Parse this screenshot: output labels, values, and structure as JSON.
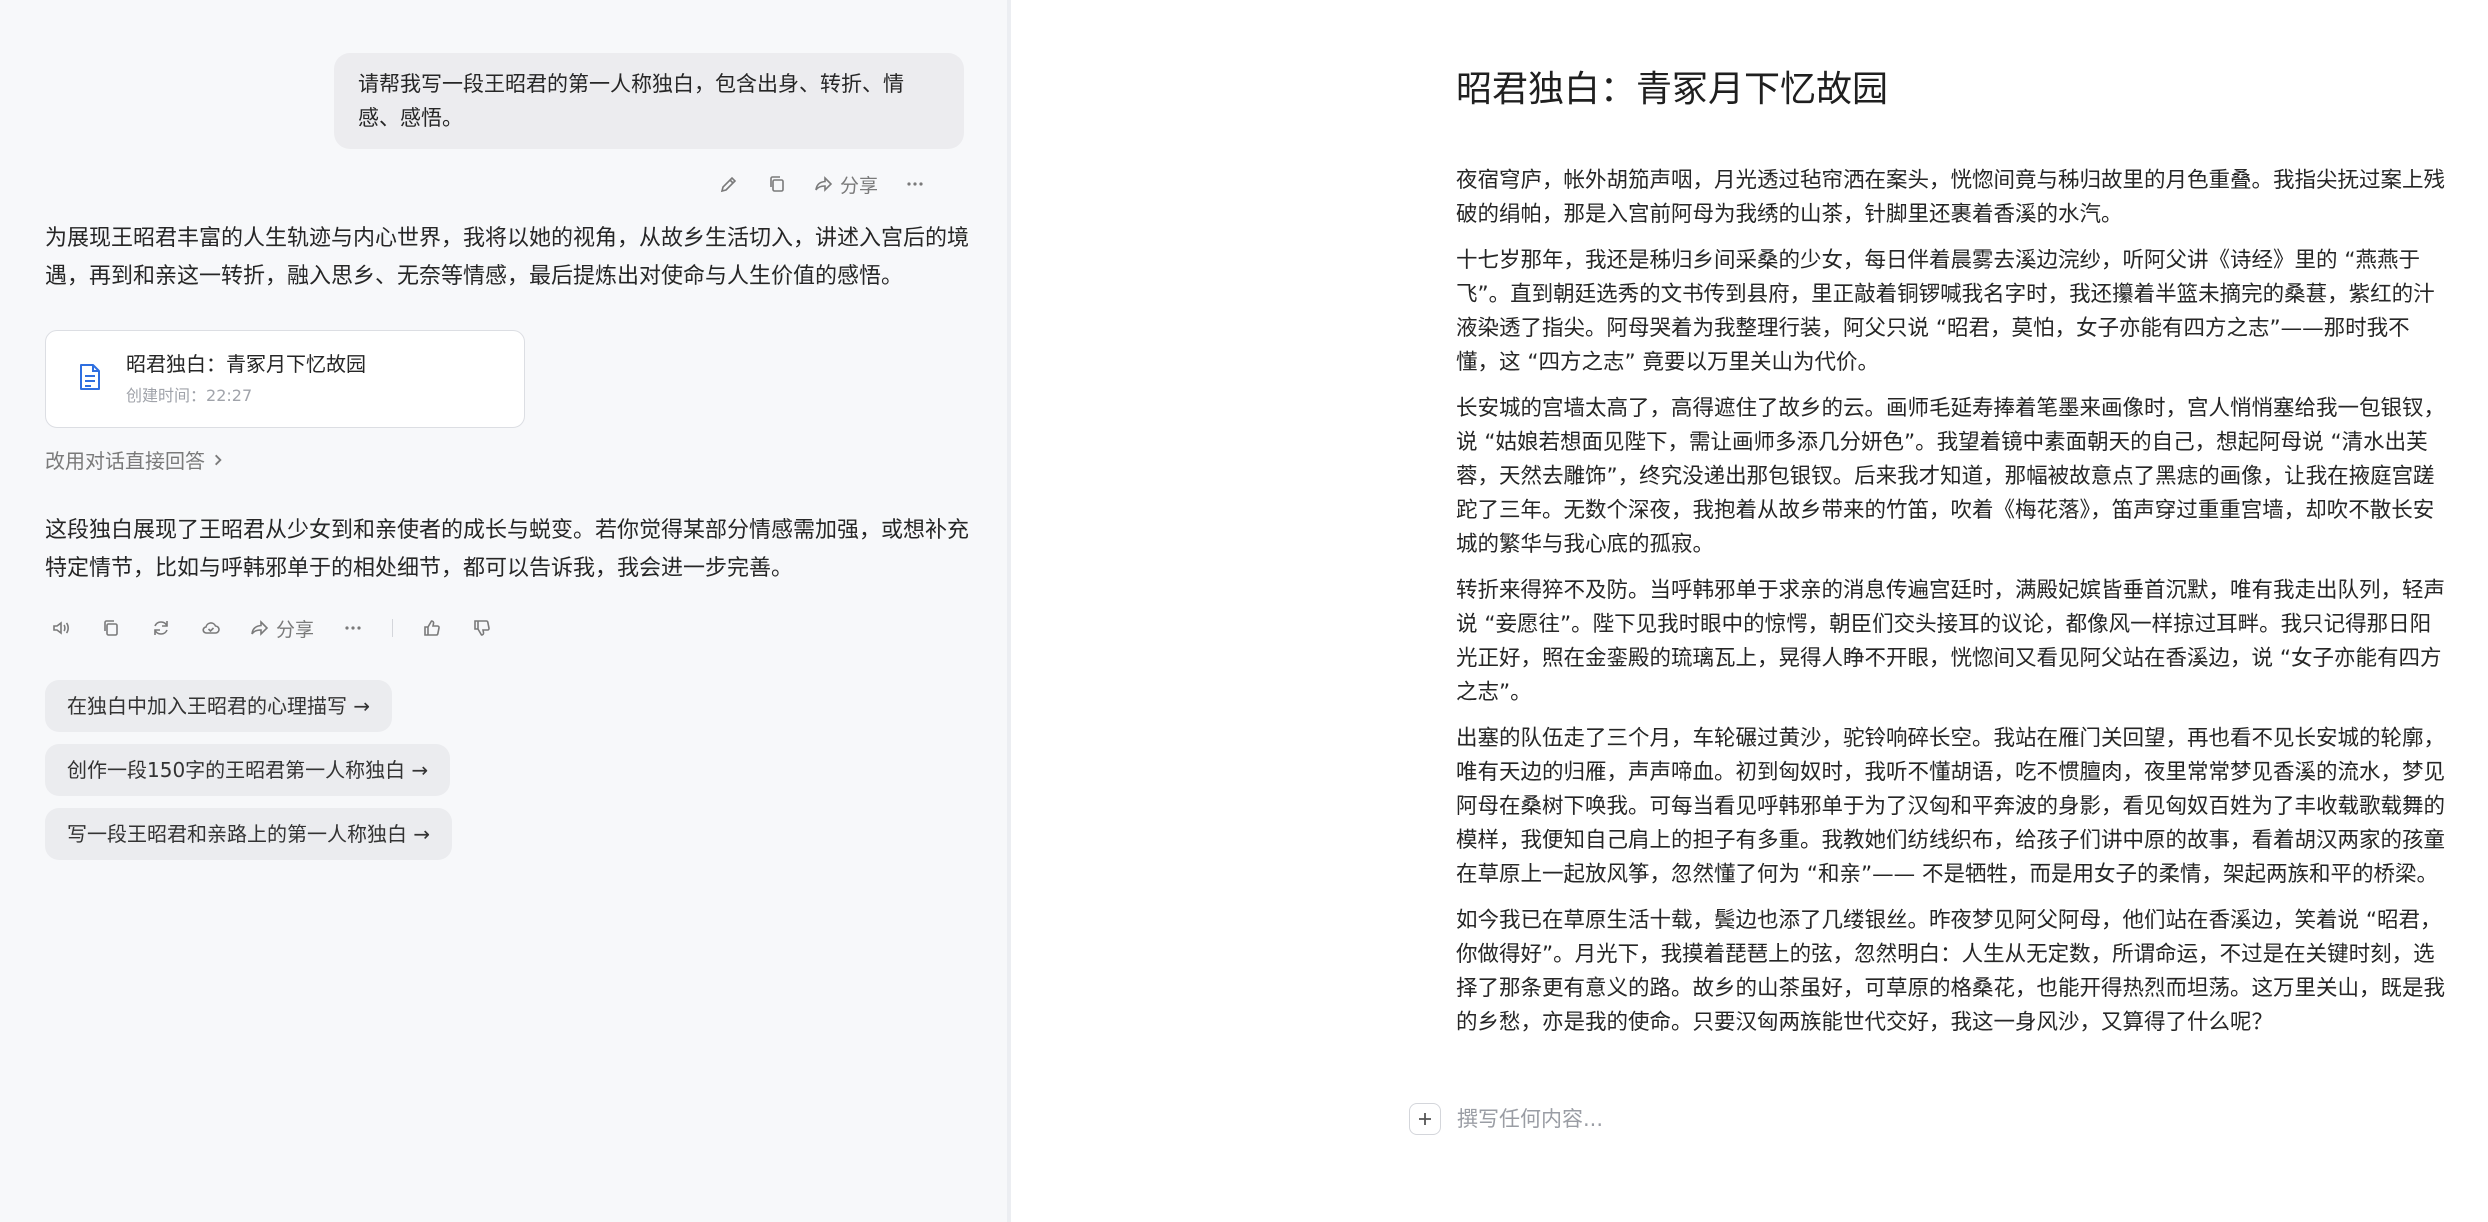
{
  "chat": {
    "user_message": "请帮我写一段王昭君的第一人称独白，包含出身、转折、情感、感悟。",
    "user_actions": {
      "edit_icon": "pencil-icon",
      "copy_icon": "copy-icon",
      "share_label": "分享",
      "more_icon": "more-icon"
    },
    "ai_intro": "为展现王昭君丰富的人生轨迹与内心世界，我将以她的视角，从故乡生活切入，讲述入宫后的境遇，再到和亲这一转折，融入思乡、无奈等情感，最后提炼出对使命与人生价值的感悟。",
    "doc_card": {
      "title": "昭君独白：青冢月下忆故园",
      "created_label": "创建时间：",
      "created_time": "22:27",
      "icon": "document-icon"
    },
    "switch_link": "改用对话直接回答",
    "ai_followup": "这段独白展现了王昭君从少女到和亲使者的成长与蜕变。若你觉得某部分情感需加强，或想补充特定情节，比如与呼韩邪单于的相处细节，都可以告诉我，我会进一步完善。",
    "ai_actions": {
      "share_label": "分享"
    },
    "suggestions": [
      "在独白中加入王昭君的心理描写 →",
      "创作一段150字的王昭君第一人称独白 →",
      "写一段王昭君和亲路上的第一人称独白 →"
    ]
  },
  "document": {
    "title": "昭君独白：青冢月下忆故园",
    "paragraphs": [
      "夜宿穹庐，帐外胡笳声咽，月光透过毡帘洒在案头，恍惚间竟与秭归故里的月色重叠。我指尖抚过案上残破的绢帕，那是入宫前阿母为我绣的山茶，针脚里还裹着香溪的水汽。",
      "十七岁那年，我还是秭归乡间采桑的少女，每日伴着晨雾去溪边浣纱，听阿父讲《诗经》里的 “燕燕于飞”。直到朝廷选秀的文书传到县府，里正敲着铜锣喊我名字时，我还攥着半篮未摘完的桑葚，紫红的汁液染透了指尖。阿母哭着为我整理行装，阿父只说 “昭君，莫怕，女子亦能有四方之志”——那时我不懂，这 “四方之志” 竟要以万里关山为代价。",
      "长安城的宫墙太高了，高得遮住了故乡的云。画师毛延寿捧着笔墨来画像时，宫人悄悄塞给我一包银钗，说 “姑娘若想面见陛下，需让画师多添几分妍色”。我望着镜中素面朝天的自己，想起阿母说 “清水出芙蓉，天然去雕饰”，终究没递出那包银钗。后来我才知道，那幅被故意点了黑痣的画像，让我在掖庭宫蹉跎了三年。无数个深夜，我抱着从故乡带来的竹笛，吹着《梅花落》，笛声穿过重重宫墙，却吹不散长安城的繁华与我心底的孤寂。",
      "转折来得猝不及防。当呼韩邪单于求亲的消息传遍宫廷时，满殿妃嫔皆垂首沉默，唯有我走出队列，轻声说 “妾愿往”。陛下见我时眼中的惊愕，朝臣们交头接耳的议论，都像风一样掠过耳畔。我只记得那日阳光正好，照在金銮殿的琉璃瓦上，晃得人睁不开眼，恍惚间又看见阿父站在香溪边，说 “女子亦能有四方之志”。",
      "出塞的队伍走了三个月，车轮碾过黄沙，驼铃响碎长空。我站在雁门关回望，再也看不见长安城的轮廓，唯有天边的归雁，声声啼血。初到匈奴时，我听不懂胡语，吃不惯膻肉，夜里常常梦见香溪的流水，梦见阿母在桑树下唤我。可每当看见呼韩邪单于为了汉匈和平奔波的身影，看见匈奴百姓为了丰收载歌载舞的模样，我便知自己肩上的担子有多重。我教她们纺线织布，给孩子们讲中原的故事，看着胡汉两家的孩童在草原上一起放风筝，忽然懂了何为 “和亲”—— 不是牺牲，而是用女子的柔情，架起两族和平的桥梁。",
      "如今我已在草原生活十载，鬓边也添了几缕银丝。昨夜梦见阿父阿母，他们站在香溪边，笑着说 “昭君，你做得好”。月光下，我摸着琵琶上的弦，忽然明白：人生从无定数，所谓命运，不过是在关键时刻，选择了那条更有意义的路。故乡的山茶虽好，可草原的格桑花，也能开得热烈而坦荡。这万里关山，既是我的乡愁，亦是我的使命。只要汉匈两族能世代交好，我这一身风沙，又算得了什么呢？"
    ],
    "composer_placeholder": "撰写任何内容..."
  }
}
